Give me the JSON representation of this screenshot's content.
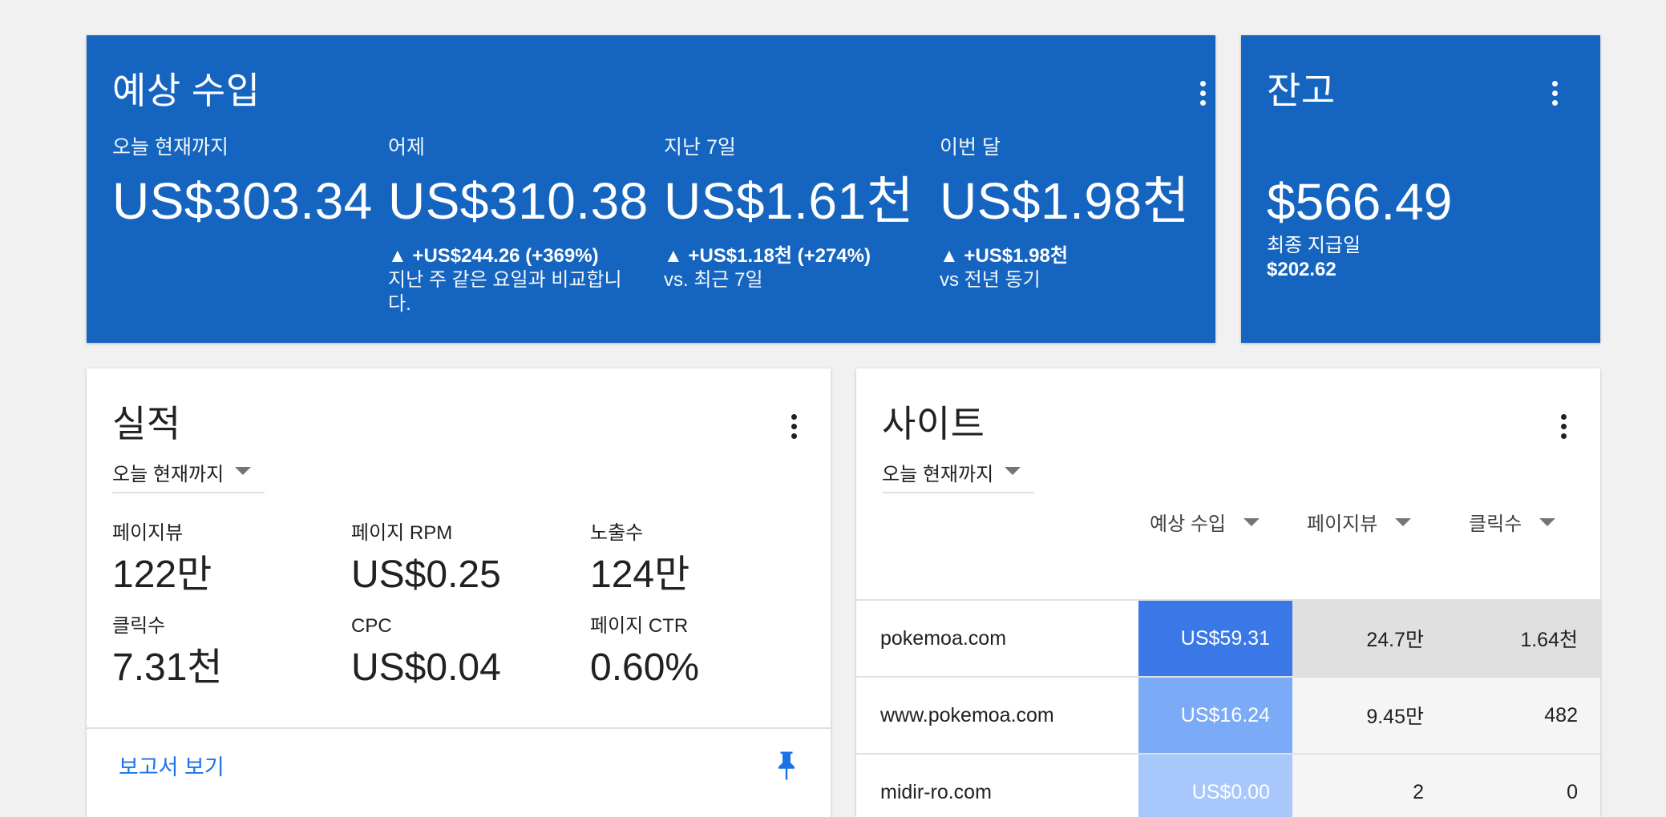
{
  "earnings": {
    "title": "예상 수입",
    "columns": [
      {
        "label": "오늘 현재까지",
        "value": "US$303.34",
        "delta": "",
        "note": ""
      },
      {
        "label": "어제",
        "value": "US$310.38",
        "delta": "▲ +US$244.26 (+369%)",
        "note": "지난 주 같은 요일과 비교합니다."
      },
      {
        "label": "지난 7일",
        "value": "US$1.61천",
        "delta": "▲ +US$1.18천 (+274%)",
        "note": "vs. 최근 7일"
      },
      {
        "label": "이번 달",
        "value": "US$1.98천",
        "delta": "▲ +US$1.98천",
        "note": "vs 전년 동기"
      }
    ]
  },
  "balance": {
    "title": "잔고",
    "value": "$566.49",
    "last_payment_label": "최종 지급일",
    "last_payment_value": "$202.62"
  },
  "performance": {
    "title": "실적",
    "range": "오늘 현재까지",
    "metrics": [
      {
        "label": "페이지뷰",
        "value": "122만"
      },
      {
        "label": "페이지 RPM",
        "value": "US$0.25"
      },
      {
        "label": "노출수",
        "value": "124만"
      },
      {
        "label": "클릭수",
        "value": "7.31천"
      },
      {
        "label": "CPC",
        "value": "US$0.04"
      },
      {
        "label": "페이지 CTR",
        "value": "0.60%"
      }
    ],
    "report_link": "보고서 보기"
  },
  "sites": {
    "title": "사이트",
    "range": "오늘 현재까지",
    "headers": [
      "예상 수입",
      "페이지뷰",
      "클릭수"
    ],
    "rows": [
      {
        "site": "pokemoa.com",
        "earnings": "US$59.31",
        "pageviews": "24.7만",
        "clicks": "1.64천",
        "heat": "#3b78e7"
      },
      {
        "site": "www.pokemoa.com",
        "earnings": "US$16.24",
        "pageviews": "9.45만",
        "clicks": "482",
        "heat": "#7baaf7"
      },
      {
        "site": "midir-ro.com",
        "earnings": "US$0.00",
        "pageviews": "2",
        "clicks": "0",
        "heat": "#a8c7fa"
      }
    ]
  },
  "colors": {
    "primary_blue": "#1565c0",
    "link_blue": "#1a73e8",
    "heat_dark": "#3b78e7",
    "heat_mid": "#7baaf7",
    "heat_light": "#a8c7fa",
    "highlight_gray": "#e0e0e0",
    "row_gray": "#f5f5f5"
  },
  "icons": {
    "menu": "more-vert-icon",
    "pin": "pin-icon",
    "dropdown": "arrow-drop-down-icon"
  }
}
